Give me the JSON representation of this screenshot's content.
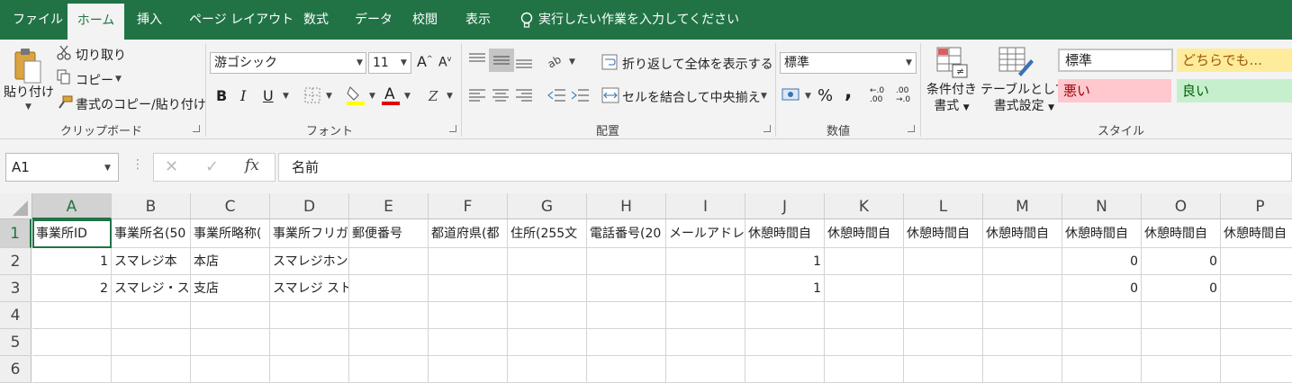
{
  "tabs": [
    "ファイル",
    "ホーム",
    "挿入",
    "ページ レイアウト",
    "数式",
    "データ",
    "校閲",
    "表示"
  ],
  "tell_me": "実行したい作業を入力してください",
  "clipboard": {
    "paste": "貼り付け",
    "cut": "切り取り",
    "copy": "コピー",
    "format_painter": "書式のコピー/貼り付け",
    "label": "クリップボード"
  },
  "font": {
    "name": "游ゴシック",
    "size": "11",
    "bold": "B",
    "italic": "I",
    "underline": "U",
    "label": "フォント"
  },
  "alignment": {
    "wrap": "折り返して全体を表示する",
    "merge": "セルを結合して中央揃え",
    "label": "配置"
  },
  "number": {
    "format": "標準",
    "percent": "%",
    "comma": ",",
    "inc": "←.0 .00",
    "dec": ".00 →.0",
    "label": "数値"
  },
  "styles": {
    "cond_format": [
      "条件付き",
      "書式"
    ],
    "table_format": [
      "テーブルとして",
      "書式設定"
    ],
    "cells": {
      "normal": "標準",
      "neutral": "どちらでも...",
      "bad": "悪い",
      "good": "良い"
    },
    "label": "スタイル"
  },
  "colors": {
    "accent": "#217346",
    "bad_bg": "#ffc7ce",
    "bad_fg": "#9c0006",
    "good_bg": "#c6efce",
    "good_fg": "#006100",
    "neutral_bg": "#ffeb9c",
    "neutral_fg": "#9c5700"
  },
  "formula_bar": {
    "namebox": "A1",
    "content": "名前",
    "fx": "fx"
  },
  "columns": [
    "A",
    "B",
    "C",
    "D",
    "E",
    "F",
    "G",
    "H",
    "I",
    "J",
    "K",
    "L",
    "M",
    "N",
    "O",
    "P"
  ],
  "rows": [
    "1",
    "2",
    "3",
    "4",
    "5",
    "6"
  ],
  "cells": {
    "r1": [
      "事業所ID",
      "事業所名(50",
      "事業所略称(",
      "事業所フリガ",
      "郵便番号",
      "都道府県(都",
      "住所(255文",
      "電話番号(20",
      "メールアドレ",
      "休憩時間自",
      "休憩時間自",
      "休憩時間自",
      "休憩時間自",
      "休憩時間自",
      "休憩時間自",
      "休憩時間自"
    ],
    "r2": [
      "1",
      "スマレジ本",
      "本店",
      "スマレジホン",
      "",
      "",
      "",
      "",
      "",
      "1",
      "",
      "",
      "",
      "0",
      "0",
      ""
    ],
    "r3": [
      "2",
      "スマレジ・ス",
      "支店",
      "スマレジ スト",
      "",
      "",
      "",
      "",
      "",
      "1",
      "",
      "",
      "",
      "0",
      "0",
      ""
    ]
  }
}
